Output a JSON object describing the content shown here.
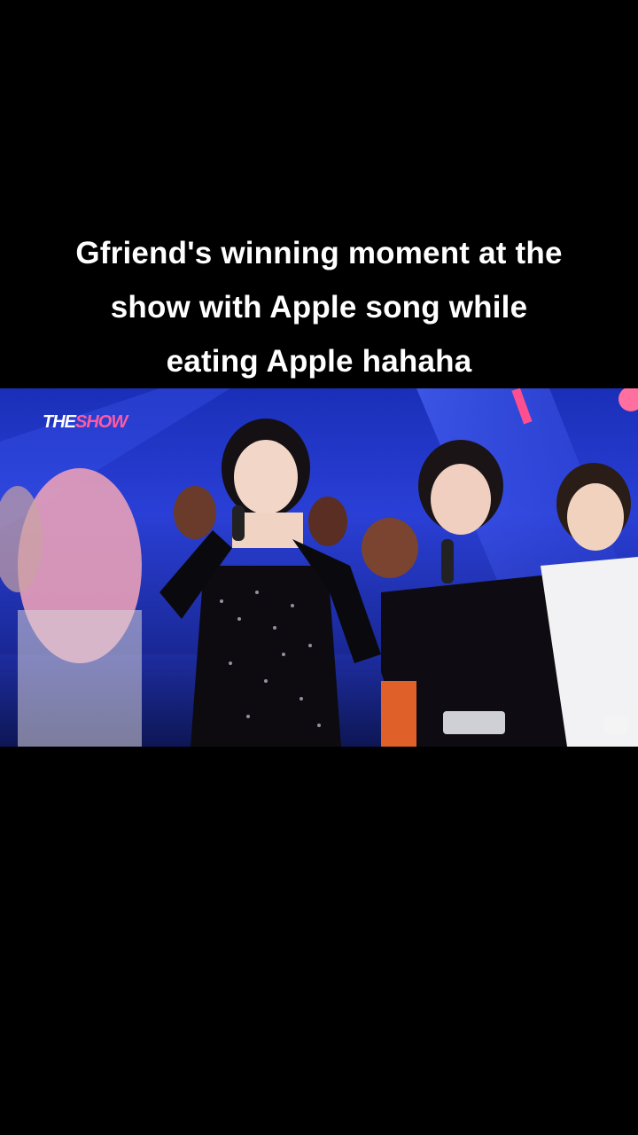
{
  "caption": {
    "lines": [
      "Gfriend's winning moment at the",
      "show with Apple song while",
      "eating Apple hahaha"
    ]
  },
  "video": {
    "show_logo": {
      "part1": "THE",
      "part2": "SHOW"
    },
    "colors": {
      "stage_blue": "#2a3fd6",
      "logo_pink": "#ff5aa0"
    }
  }
}
